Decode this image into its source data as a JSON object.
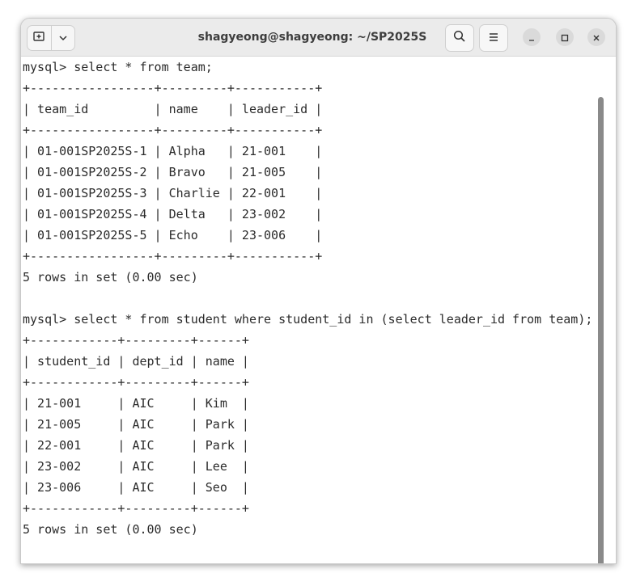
{
  "window": {
    "title": "shagyeong@shagyeong: ~/SP2025S"
  },
  "titlebar": {
    "new_tab_icon": "new-tab-icon",
    "menu_dropdown_icon": "chevron-down-icon",
    "search_icon": "search-icon",
    "hamburger_icon": "hamburger-menu-icon",
    "minimize_icon": "minimize-icon",
    "maximize_icon": "maximize-icon",
    "close_icon": "close-icon"
  },
  "terminal": {
    "lines": [
      "mysql> select * from team;",
      "+-----------------+---------+-----------+",
      "| team_id         | name    | leader_id |",
      "+-----------------+---------+-----------+",
      "| 01-001SP2025S-1 | Alpha   | 21-001    |",
      "| 01-001SP2025S-2 | Bravo   | 21-005    |",
      "| 01-001SP2025S-3 | Charlie | 22-001    |",
      "| 01-001SP2025S-4 | Delta   | 23-002    |",
      "| 01-001SP2025S-5 | Echo    | 23-006    |",
      "+-----------------+---------+-----------+",
      "5 rows in set (0.00 sec)",
      "",
      "mysql> select * from student where student_id in (select leader_id from team);",
      "+------------+---------+------+",
      "| student_id | dept_id | name |",
      "+------------+---------+------+",
      "| 21-001     | AIC     | Kim  |",
      "| 21-005     | AIC     | Park |",
      "| 22-001     | AIC     | Park |",
      "| 23-002     | AIC     | Lee  |",
      "| 23-006     | AIC     | Seo  |",
      "+------------+---------+------+",
      "5 rows in set (0.00 sec)"
    ]
  }
}
